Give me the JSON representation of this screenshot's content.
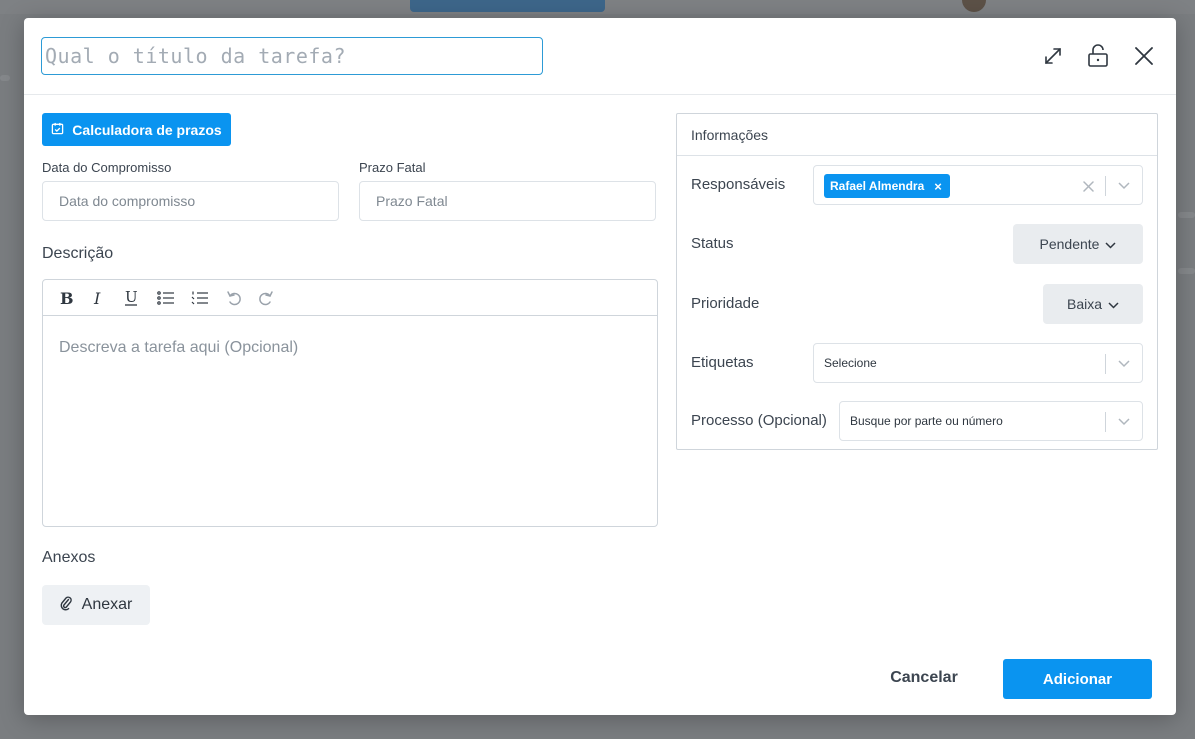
{
  "modal": {
    "title_placeholder": "Qual o título da tarefa?",
    "icons": [
      "expand-icon",
      "lock-icon",
      "close-icon"
    ]
  },
  "left": {
    "calc_button": "Calculadora de prazos",
    "date_label": "Data do Compromisso",
    "date_placeholder": "Data do compromisso",
    "deadline_label": "Prazo Fatal",
    "deadline_placeholder": "Prazo Fatal",
    "description_label": "Descrição",
    "description_placeholder": "Descreva a tarefa aqui (Opcional)",
    "toolbar": [
      "bold-icon",
      "italic-icon",
      "underline-icon",
      "bullet-list-icon",
      "numbered-list-icon",
      "undo-icon",
      "redo-icon"
    ],
    "attachments_label": "Anexos",
    "attach_button": "Anexar"
  },
  "info": {
    "title": "Informações",
    "responsaveis_label": "Responsáveis",
    "responsavel_chip": "Rafael Almendra",
    "chip_remove": "×",
    "status_label": "Status",
    "status_value": "Pendente",
    "prioridade_label": "Prioridade",
    "prioridade_value": "Baixa",
    "etiquetas_label": "Etiquetas",
    "etiquetas_placeholder": "Selecione",
    "processo_label": "Processo (Opcional)",
    "processo_placeholder": "Busque por parte ou número"
  },
  "footer": {
    "cancel": "Cancelar",
    "add": "Adicionar"
  },
  "colors": {
    "primary": "#0a94f0",
    "overlay": "#6f7275"
  }
}
